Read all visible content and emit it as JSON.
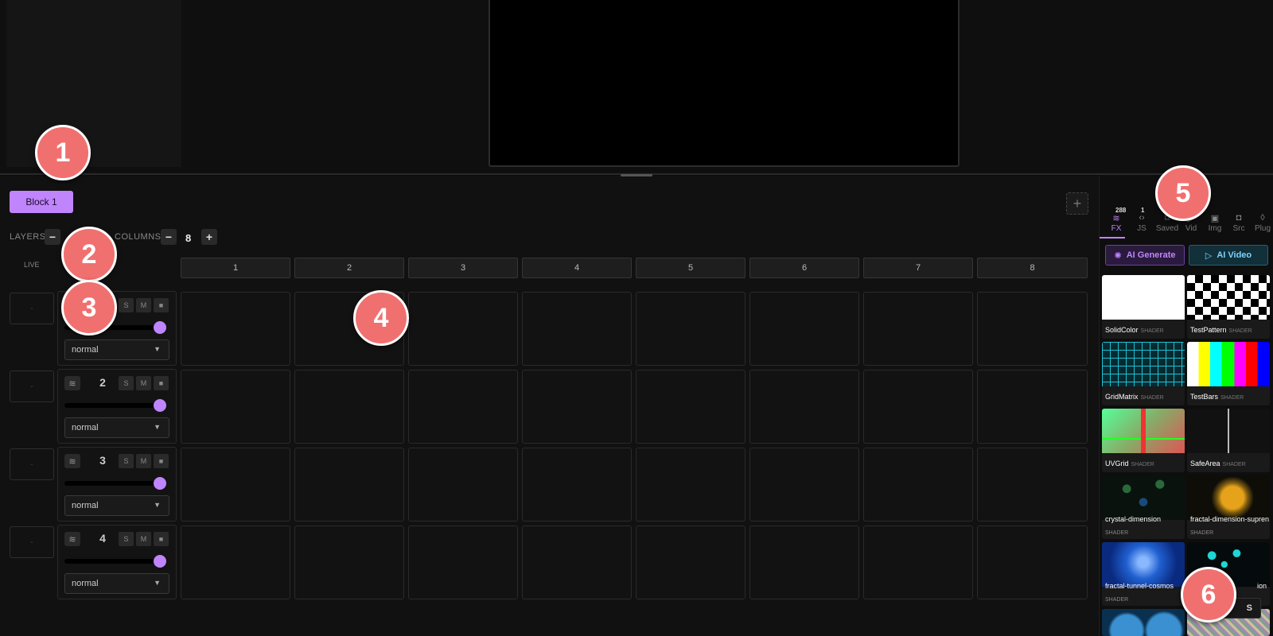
{
  "main": {
    "block_tab": "Block 1",
    "add_block": "+",
    "layers_label": "LAYERS",
    "columns_label": "COLUMNS",
    "minus": "−",
    "plus": "+",
    "columns_count": "8",
    "live_label": "LIVE",
    "column_headers": [
      "1",
      "2",
      "3",
      "4",
      "5",
      "6",
      "7",
      "8"
    ],
    "layers": [
      {
        "num": "",
        "live": "-",
        "blend": "normal",
        "s": "S",
        "m": "M",
        "x": "■"
      },
      {
        "num": "2",
        "live": "-",
        "blend": "normal",
        "s": "S",
        "m": "M",
        "x": "■"
      },
      {
        "num": "3",
        "live": "-",
        "blend": "normal",
        "s": "S",
        "m": "M",
        "x": "■"
      },
      {
        "num": "4",
        "live": "-",
        "blend": "normal",
        "s": "S",
        "m": "M",
        "x": "■"
      }
    ]
  },
  "right_panel": {
    "tabs": [
      {
        "label": "FX",
        "badge": "288",
        "icon": "layers-icon"
      },
      {
        "label": "JS",
        "badge": "1",
        "icon": "code-icon"
      },
      {
        "label": "Saved",
        "badge": "",
        "icon": "bookmark-icon"
      },
      {
        "label": "Vid",
        "badge": "",
        "icon": "video-icon"
      },
      {
        "label": "Img",
        "badge": "",
        "icon": "image-icon"
      },
      {
        "label": "Src",
        "badge": "",
        "icon": "camera-icon"
      },
      {
        "label": "Plug",
        "badge": "",
        "icon": "drop-icon"
      }
    ],
    "ai_generate": "AI Generate",
    "ai_video": "AI Video",
    "fx_items": [
      {
        "name": "SolidColor",
        "kind": "SHADER"
      },
      {
        "name": "TestPattern",
        "kind": "SHADER"
      },
      {
        "name": "GridMatrix",
        "kind": "SHADER"
      },
      {
        "name": "TestBars",
        "kind": "SHADER"
      },
      {
        "name": "UVGrid",
        "kind": "SHADER"
      },
      {
        "name": "SafeArea",
        "kind": "SHADER"
      },
      {
        "name": "crystal-dimension",
        "kind": "SHADER"
      },
      {
        "name": "fractal-dimension-supren",
        "kind": "SHADER"
      },
      {
        "name": "fractal-tunnel-cosmos",
        "kind": "SHADER"
      },
      {
        "name": "ion",
        "kind": ""
      }
    ],
    "fps_badge": "S"
  },
  "callouts": [
    "1",
    "2",
    "3",
    "4",
    "5",
    "6"
  ],
  "colors": {
    "accent": "#c084fc",
    "callout": "#f07070"
  }
}
